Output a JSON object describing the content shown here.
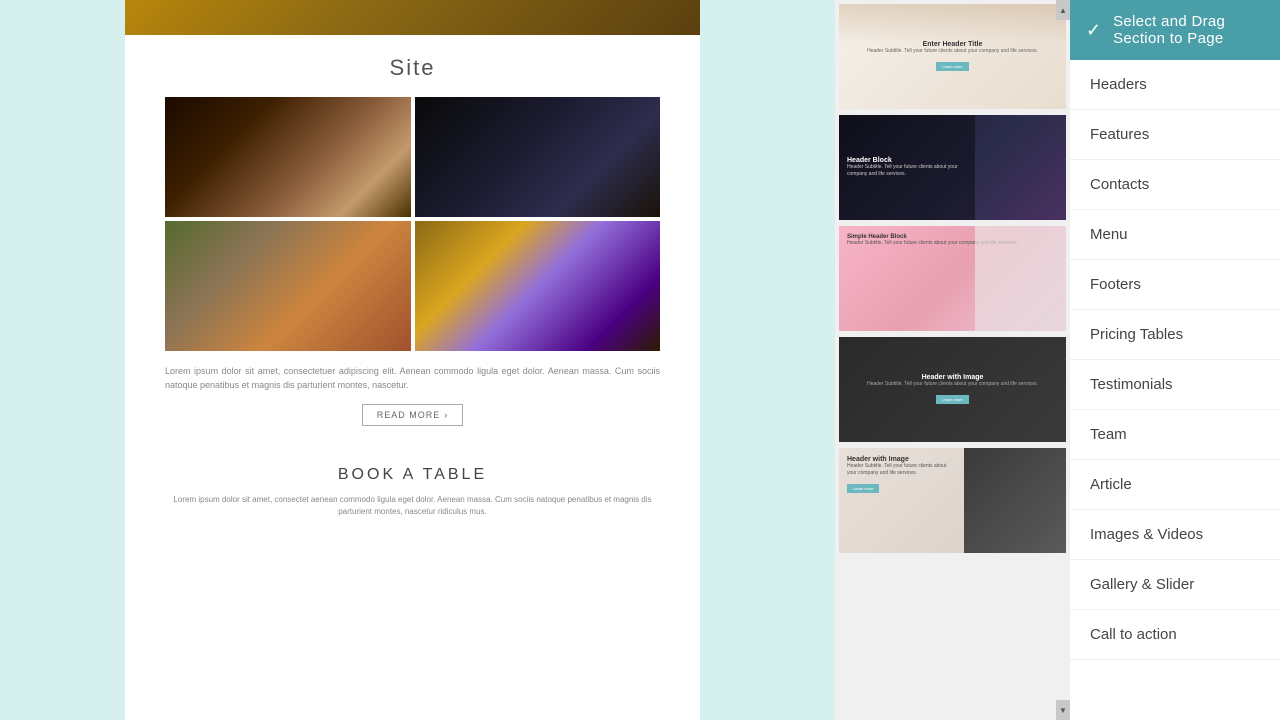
{
  "header": {
    "title": "Select and Drag Section to Page",
    "check_icon": "✓"
  },
  "categories": [
    {
      "id": "headers",
      "label": "Headers"
    },
    {
      "id": "features",
      "label": "Features"
    },
    {
      "id": "contacts",
      "label": "Contacts"
    },
    {
      "id": "menu",
      "label": "Menu"
    },
    {
      "id": "footers",
      "label": "Footers"
    },
    {
      "id": "pricing-tables",
      "label": "Pricing Tables"
    },
    {
      "id": "testimonials",
      "label": "Testimonials"
    },
    {
      "id": "team",
      "label": "Team"
    },
    {
      "id": "article",
      "label": "Article"
    },
    {
      "id": "images-videos",
      "label": "Images & Videos"
    },
    {
      "id": "gallery-slider",
      "label": "Gallery & Slider"
    },
    {
      "id": "call-to-action",
      "label": "Call to action"
    }
  ],
  "thumbnails": [
    {
      "id": "thumb-header-1",
      "title": "Enter Header Title",
      "subtitle": "Header Subtitle. Tell your future clients about your company and life services.",
      "btn": "Learn more"
    },
    {
      "id": "thumb-header-2",
      "title": "Header Block",
      "subtitle": "Header Subtitle. Tell your future clients about your company and life services."
    },
    {
      "id": "thumb-header-3",
      "title": "Simple Header Block",
      "subtitle": "Header Subtitle. Tell your future clients about your company and life services."
    },
    {
      "id": "thumb-header-4",
      "title": "Header with Image",
      "subtitle": "Header Subtitle. Tell your future clients about your company and life services.",
      "btn": "Learn more"
    },
    {
      "id": "thumb-header-5",
      "title": "Header with Image",
      "subtitle": "Header Subtitle. Tell your future clients about your company and life services.",
      "btn": "Learn more"
    }
  ],
  "preview": {
    "site_title": "Site",
    "lorem_text": "Lorem ipsum dolor sit amet, consectetuer adipiscing elit. Aenean commodo ligula eget dolor. Aenean massa. Cum sociis natoque penatibus et magnis dis parturient montes, nascetur.",
    "read_more": "READ MORE",
    "book_title": "BOOK A TABLE",
    "book_text": "Lorem ipsum dolor sit amet, consectet aenean commodo ligula eget dolor. Aenean massa. Cum sociis natoque penatibus et magnis dis parturient montes, nascetur ridiculus mus."
  }
}
